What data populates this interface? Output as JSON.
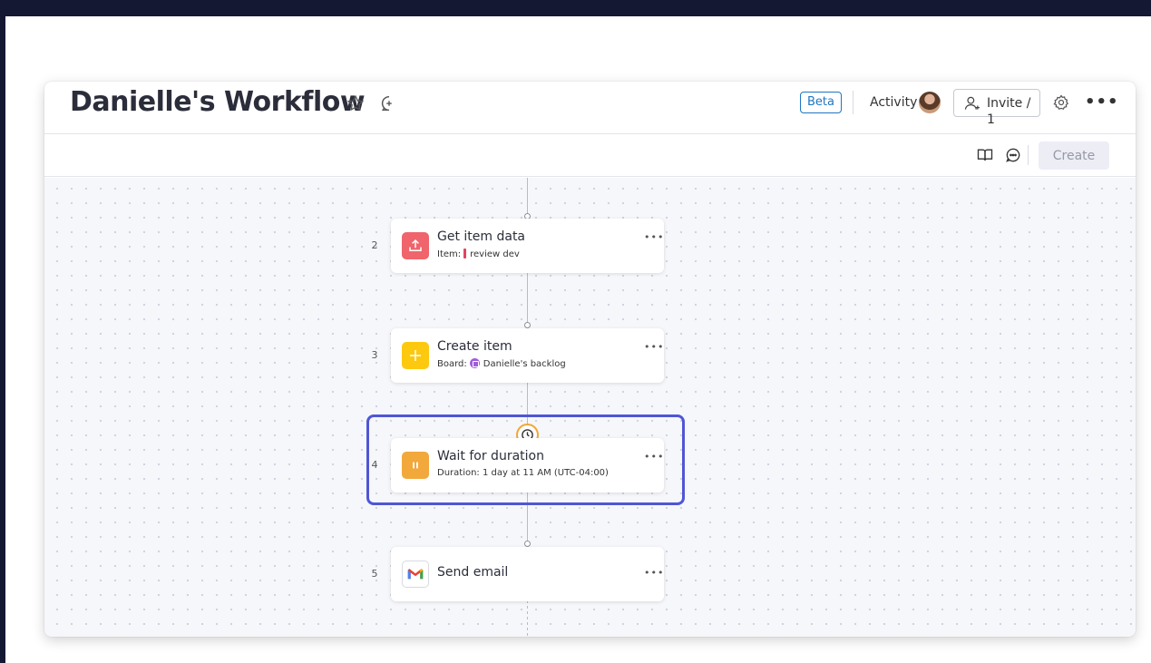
{
  "header": {
    "title": "Danielle's Workflow",
    "beta_label": "Beta",
    "activity_label": "Activity",
    "invite_label": "Invite / 1"
  },
  "toolbar": {
    "create_label": "Create"
  },
  "steps": [
    {
      "number": "2",
      "title": "Get item data",
      "sub_label": "Item:",
      "sub_value": "review dev",
      "icon": "upload-icon",
      "icon_color": "#f0646b"
    },
    {
      "number": "3",
      "title": "Create item",
      "sub_label": "Board:",
      "sub_value": "Danielle's backlog",
      "icon": "plus-icon",
      "icon_color": "#fdc90f"
    },
    {
      "number": "4",
      "title": "Wait for duration",
      "sub_label": "Duration:",
      "sub_value": "1 day at 11 AM (UTC-04:00)",
      "icon": "pause-icon",
      "icon_color": "#f2a83b"
    },
    {
      "number": "5",
      "title": "Send email",
      "icon": "gmail-icon"
    }
  ],
  "colors": {
    "accent_highlight": "#4f56d6",
    "beta_blue": "#1f76c2",
    "clock_orange": "#f1a73a",
    "item_status_red": "#e2445c",
    "board_purple": "#a25ddc"
  }
}
